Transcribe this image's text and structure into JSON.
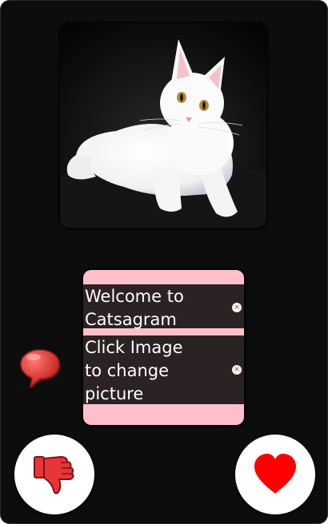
{
  "app": {
    "name": "Catsagram"
  },
  "photo": {
    "alt": "white cat",
    "icon": "cat-photo"
  },
  "messages": [
    {
      "text": "Welcome to\nCatsagram",
      "close_icon": "close-icon"
    },
    {
      "text": "Click Image\nto change\npicture",
      "close_icon": "close-icon"
    }
  ],
  "icons": {
    "chat": "speech-bubble-icon",
    "dislike": "thumbs-down-icon",
    "like": "heart-icon",
    "close_glyph": "×"
  },
  "colors": {
    "background": "#0d0d0d",
    "panel": "#ffc0cb",
    "message_bg": "#2b2224",
    "heart": "#ff0000",
    "thumb": "#e8353a",
    "bubble": "#e84040"
  }
}
